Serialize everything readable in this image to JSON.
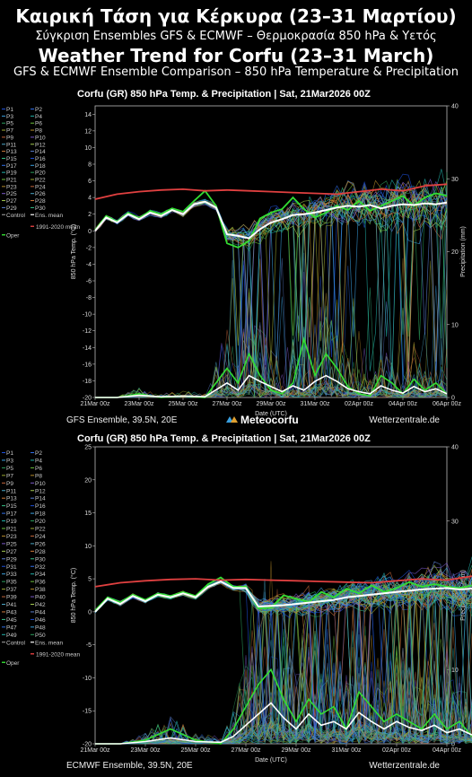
{
  "header": {
    "title_gr": "Καιρική Τάση για Κέρκυρα (23–31 Μαρτίου)",
    "subtitle_gr": "Σύγκριση Ensembles GFS & ECMWF – Θερμοκρασία 850 hPa & Υετός",
    "title_en": "Weather Trend for Corfu (23–31 March)",
    "subtitle_en": "GFS & ECMWF Ensemble Comparison – 850 hPa Temperature & Precipitation"
  },
  "logo_text": "Meteocorfu",
  "colors": {
    "mean": "#ffffff",
    "climate": "#e04040",
    "oper": "#33dd33",
    "axis": "#cccccc"
  },
  "chart_data": [
    {
      "type": "line",
      "title": "Corfu   (GR)   850 hPa Temp. & Precipitation | Sat, 21Mar2026 00Z",
      "footer_left": "GFS Ensemble, 39.5N, 20E",
      "footer_right": "Wetterzentrale.de",
      "xlabel": "Date (UTC)",
      "ylabel": "850 hPa Temp. (°C)",
      "y2label": "Precipitation (mm)",
      "x_ticks": [
        "21Mar 00z",
        "23Mar 00z",
        "25Mar 00z",
        "27Mar 00z",
        "29Mar 00z",
        "31Mar 00z",
        "02Apr 00z",
        "04Apr 00z",
        "06Apr 00z"
      ],
      "ylim": [
        -20,
        15
      ],
      "y_ticks": [
        "14",
        "12",
        "10",
        "8",
        "6",
        "4",
        "2",
        "0",
        "-2",
        "-4",
        "-6",
        "-8",
        "-10",
        "-12",
        "-14",
        "-16",
        "-18",
        "-20"
      ],
      "y2lim": [
        0,
        40
      ],
      "y2_ticks": [
        "40",
        "30",
        "20",
        "10",
        "0"
      ],
      "legend": {
        "members": [
          "P1",
          "P2",
          "P3",
          "P4",
          "P5",
          "P6",
          "P7",
          "P8",
          "P9",
          "P10",
          "P11",
          "P12",
          "P13",
          "P14",
          "P15",
          "P16",
          "P17",
          "P18",
          "P19",
          "P20",
          "P21",
          "P22",
          "P23",
          "P24",
          "P25",
          "P26",
          "P27",
          "P28",
          "P29",
          "P30"
        ],
        "control": "Control",
        "ens_mean": "Ens. mean",
        "oper": "Oper",
        "climate": "1991-2020 mean"
      },
      "series": [
        {
          "name": "1991-2020 mean",
          "kind": "temp",
          "x": [
            0,
            1,
            2,
            3,
            4,
            5,
            6,
            7,
            8,
            9,
            10,
            11,
            12,
            13,
            14,
            15,
            16
          ],
          "values": [
            3.8,
            4.4,
            4.7,
            4.9,
            5.0,
            4.8,
            4.9,
            4.8,
            4.7,
            4.6,
            4.5,
            4.4,
            4.7,
            5.0,
            4.8,
            5.4,
            5.6
          ]
        },
        {
          "name": "Ens. mean",
          "kind": "temp",
          "x": [
            0,
            0.5,
            1,
            1.5,
            2,
            2.5,
            3,
            3.5,
            4,
            4.5,
            5,
            5.5,
            6,
            6.5,
            7,
            7.5,
            8,
            8.5,
            9,
            9.5,
            10,
            10.5,
            11,
            11.5,
            12,
            12.5,
            13,
            13.5,
            14,
            14.5,
            15,
            15.5,
            16
          ],
          "values": [
            0.0,
            1.6,
            1.0,
            2.0,
            1.4,
            2.2,
            1.8,
            2.5,
            2.0,
            3.2,
            3.5,
            2.8,
            -0.4,
            -0.6,
            -0.9,
            0.2,
            1.0,
            1.4,
            1.9,
            2.0,
            2.2,
            2.5,
            2.8,
            3.0,
            2.9,
            3.1,
            2.7,
            3.0,
            3.2,
            3.1,
            3.3,
            3.2,
            3.4
          ]
        },
        {
          "name": "Oper",
          "kind": "temp",
          "x": [
            0,
            0.5,
            1,
            1.5,
            2,
            2.5,
            3,
            3.5,
            4,
            4.5,
            5,
            5.5,
            6,
            6.5,
            7,
            7.5,
            8,
            8.5,
            9,
            9.5,
            10,
            10.5,
            11,
            11.5,
            12,
            12.5,
            13,
            13.5,
            14,
            14.5,
            15,
            15.5,
            16
          ],
          "values": [
            0.1,
            1.8,
            1.1,
            2.2,
            1.5,
            2.4,
            2.0,
            2.7,
            2.3,
            3.6,
            4.8,
            3.0,
            -1.5,
            -2.0,
            -1.2,
            1.5,
            2.2,
            2.6,
            4.0,
            2.6,
            1.6,
            2.2,
            3.0,
            2.5,
            3.6,
            2.4,
            3.0,
            3.6,
            4.2,
            3.0,
            4.0,
            4.5,
            4.2
          ]
        },
        {
          "name": "Ens. mean",
          "kind": "precip",
          "x": [
            0,
            1,
            2,
            3,
            4,
            5,
            6,
            6.5,
            7,
            7.5,
            8,
            8.5,
            9,
            9.5,
            10,
            10.5,
            11,
            11.5,
            12,
            12.5,
            13,
            13.5,
            14,
            14.5,
            15,
            15.5,
            16
          ],
          "values": [
            0,
            0,
            0.3,
            0.1,
            0.2,
            0.1,
            2.0,
            1.0,
            3.0,
            2.2,
            1.5,
            0.8,
            1.6,
            1.0,
            2.2,
            3.0,
            2.2,
            1.2,
            0.8,
            0.5,
            1.6,
            1.0,
            0.6,
            1.5,
            0.8,
            1.2,
            0.5
          ]
        },
        {
          "name": "Oper",
          "kind": "precip",
          "x": [
            0,
            1,
            2,
            3,
            4,
            5,
            6,
            6.5,
            7,
            7.5,
            8,
            8.5,
            9,
            9.5,
            10,
            10.5,
            11,
            11.5,
            12,
            12.5,
            13,
            13.5,
            14,
            14.5,
            15,
            15.5,
            16
          ],
          "values": [
            0,
            0,
            0.5,
            0,
            0.2,
            0,
            4.0,
            2.0,
            6.0,
            3.0,
            1.0,
            0.5,
            2.0,
            8.0,
            3.0,
            6.0,
            4.0,
            1.5,
            0.5,
            0.2,
            3.0,
            2.0,
            0.5,
            2.5,
            1.0,
            2.0,
            0.5
          ]
        }
      ]
    },
    {
      "type": "line",
      "title": "Corfu   (GR)   850 hPa Temp. & Precipitation | Sat, 21Mar2026 00Z",
      "footer_left": "ECMWF Ensemble, 39.5N, 20E",
      "footer_right": "Wetterzentrale.de",
      "xlabel": "Date (UTC)",
      "ylabel": "850 hPa Temp. (°C)",
      "y2label": "Precipitation (mm)",
      "x_ticks": [
        "21Mar 00z",
        "23Mar 00z",
        "25Mar 00z",
        "27Mar 00z",
        "29Mar 00z",
        "31Mar 00z",
        "02Apr 00z",
        "04Apr 00z"
      ],
      "ylim": [
        -20,
        25
      ],
      "y_ticks": [
        "25",
        "20",
        "15",
        "10",
        "5",
        "0",
        "-5",
        "-10",
        "-15",
        "-20"
      ],
      "y2lim": [
        0,
        40
      ],
      "y2_ticks": [
        "40",
        "30",
        "20",
        "10",
        "0"
      ],
      "legend": {
        "members": [
          "P1",
          "P2",
          "P3",
          "P4",
          "P5",
          "P6",
          "P7",
          "P8",
          "P9",
          "P10",
          "P11",
          "P12",
          "P13",
          "P14",
          "P15",
          "P16",
          "P17",
          "P18",
          "P19",
          "P20",
          "P21",
          "P22",
          "P23",
          "P24",
          "P25",
          "P26",
          "P27",
          "P28",
          "P29",
          "P30",
          "P31",
          "P32",
          "P33",
          "P34",
          "P35",
          "P36",
          "P37",
          "P38",
          "P39",
          "P40",
          "P41",
          "P42",
          "P43",
          "P44",
          "P45",
          "P46",
          "P47",
          "P48",
          "P49",
          "P50"
        ],
        "control": "Control",
        "ens_mean": "Ens. mean",
        "oper": "Oper",
        "climate": "1991-2020 mean"
      },
      "series": [
        {
          "name": "1991-2020 mean",
          "kind": "temp",
          "x": [
            0,
            1,
            2,
            3,
            4,
            5,
            6,
            7,
            8,
            9,
            10,
            11,
            12,
            13,
            14,
            15
          ],
          "values": [
            3.8,
            4.4,
            4.7,
            4.9,
            5.0,
            4.8,
            4.9,
            4.8,
            4.7,
            4.6,
            4.5,
            4.4,
            4.7,
            5.0,
            4.8,
            5.4
          ]
        },
        {
          "name": "Ens. mean",
          "kind": "temp",
          "x": [
            0,
            0.5,
            1,
            1.5,
            2,
            2.5,
            3,
            3.5,
            4,
            4.5,
            5,
            5.5,
            6,
            6.5,
            7,
            7.5,
            8,
            8.5,
            9,
            9.5,
            10,
            10.5,
            11,
            11.5,
            12,
            12.5,
            13,
            13.5,
            14,
            14.5,
            15
          ],
          "values": [
            0.0,
            2.0,
            1.2,
            2.4,
            1.6,
            2.6,
            2.2,
            2.8,
            2.2,
            3.8,
            4.6,
            3.6,
            3.6,
            0.8,
            0.9,
            1.0,
            1.2,
            1.4,
            1.6,
            1.8,
            2.2,
            2.4,
            2.6,
            2.8,
            3.0,
            3.2,
            3.4,
            3.5,
            3.6,
            3.4,
            3.5
          ]
        },
        {
          "name": "Oper",
          "kind": "temp",
          "x": [
            0,
            0.5,
            1,
            1.5,
            2,
            2.5,
            3,
            3.5,
            4,
            4.5,
            5,
            5.5,
            6,
            6.5,
            7,
            7.5,
            8,
            8.5,
            9,
            9.5,
            10,
            10.5,
            11,
            11.5,
            12,
            12.5,
            13,
            13.5,
            14,
            14.5,
            15
          ],
          "values": [
            0.2,
            2.2,
            1.4,
            2.6,
            1.8,
            2.8,
            2.4,
            3.0,
            2.4,
            4.2,
            5.2,
            3.8,
            3.8,
            0.5,
            0.6,
            2.5,
            2.0,
            1.5,
            3.0,
            2.2,
            3.5,
            2.8,
            4.0,
            3.0,
            3.6,
            4.5,
            3.8,
            4.2,
            3.8,
            3.6,
            4.0
          ]
        },
        {
          "name": "Ens. mean",
          "kind": "precip",
          "x": [
            0,
            1,
            2,
            3,
            4,
            5,
            5.5,
            6,
            6.5,
            7,
            7.5,
            8,
            8.5,
            9,
            9.5,
            10,
            10.5,
            11,
            11.5,
            12,
            12.5,
            13,
            13.5,
            14,
            14.5,
            15
          ],
          "values": [
            0,
            0,
            0.3,
            0.8,
            0.3,
            0.2,
            1.0,
            2.5,
            4.0,
            5.5,
            3.5,
            2.0,
            4.0,
            2.5,
            3.0,
            2.0,
            4.2,
            3.0,
            2.0,
            3.0,
            2.2,
            1.8,
            2.5,
            1.5,
            2.0,
            1.2
          ]
        },
        {
          "name": "Oper",
          "kind": "precip",
          "x": [
            0,
            1,
            2,
            3,
            4,
            5,
            5.5,
            6,
            6.5,
            7,
            7.5,
            8,
            8.5,
            9,
            9.5,
            10,
            10.5,
            11,
            11.5,
            12,
            12.5,
            13,
            13.5,
            14,
            14.5,
            15
          ],
          "values": [
            0,
            0,
            0.5,
            2.0,
            0.5,
            0,
            2.0,
            5.0,
            8.0,
            10.0,
            6.0,
            3.0,
            6.0,
            4.0,
            5.0,
            2.0,
            7.0,
            5.0,
            3.0,
            4.0,
            3.0,
            2.0,
            4.0,
            2.0,
            3.0,
            1.0
          ]
        }
      ]
    }
  ]
}
